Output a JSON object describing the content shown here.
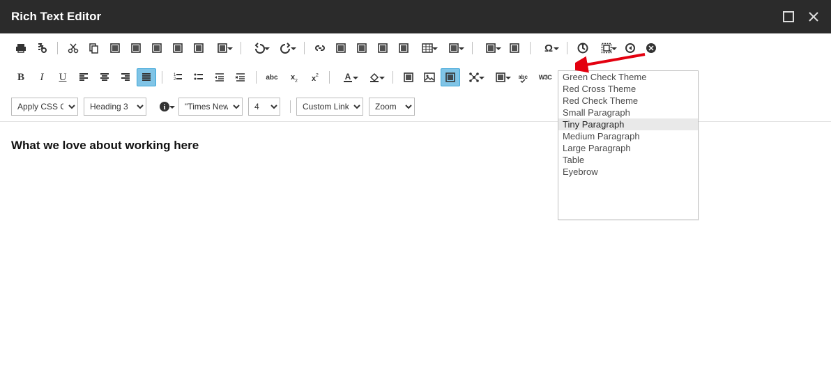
{
  "window": {
    "title": "Rich Text Editor"
  },
  "editor": {
    "heading": "What we love about working here"
  },
  "combos": {
    "css_class": "Apply CSS Cl...",
    "heading": "Heading 3",
    "font": "\"Times New ...",
    "size": "4",
    "links": "Custom Links",
    "zoom": "Zoom"
  },
  "templates_menu": {
    "items": [
      "Green Check Theme",
      "Red Cross Theme",
      "Red Check Theme",
      "Small Paragraph",
      "Tiny Paragraph",
      "Medium Paragraph",
      "Large Paragraph",
      "Table",
      "Eyebrow"
    ],
    "highlighted_index": 4
  },
  "icons_row1": [
    "print",
    "find",
    "|",
    "cut",
    "copy",
    "paste",
    "paste-text",
    "paste-word",
    "paste-html",
    "paste-rtf",
    "format-painter",
    "|",
    "undo",
    "redo",
    "|",
    "link-manager",
    "image-manager",
    "media-manager",
    "document-manager",
    "flash-manager",
    "table",
    "table-wizard",
    "|",
    "format-stripper",
    "snippet",
    "|",
    "special-char",
    "|",
    "date-time",
    "template",
    "style-builder",
    "xhtml-validator"
  ],
  "icons_row2": [
    "bold",
    "italic",
    "underline",
    "align-left",
    "align-center",
    "align-right",
    "align-justify",
    "|",
    "ordered-list",
    "unordered-list",
    "indent",
    "outdent",
    "|",
    "abc",
    "subscript",
    "superscript",
    "|",
    "font-color",
    "back-color",
    "|",
    "groupbox",
    "insert-image",
    "image-map",
    "module",
    "absolute",
    "spellcheck",
    "w3c",
    "toggle"
  ]
}
